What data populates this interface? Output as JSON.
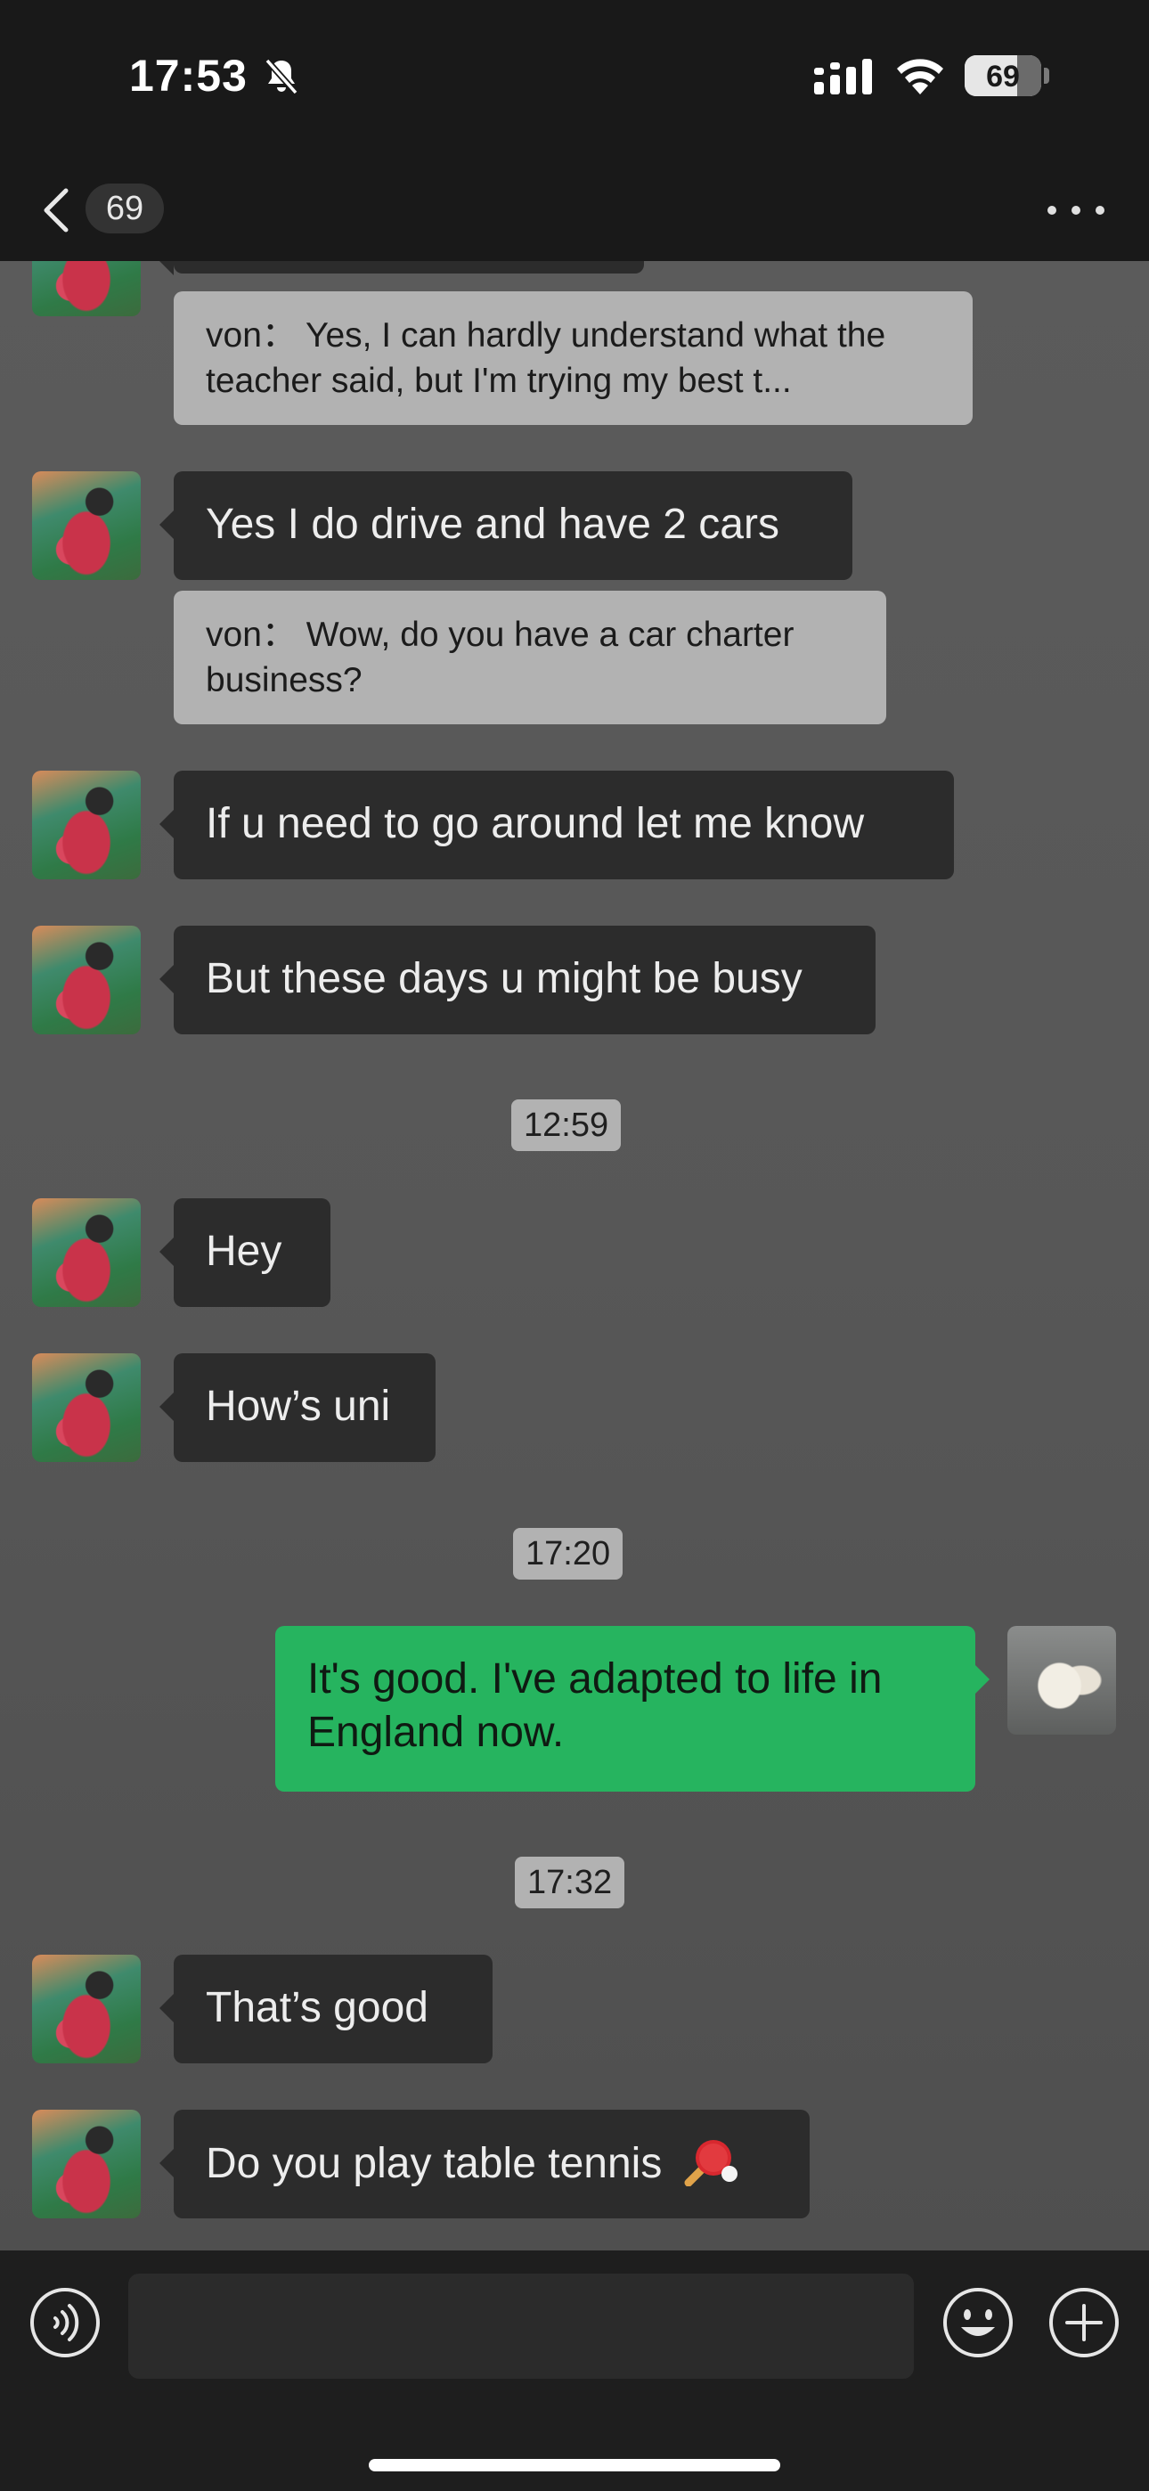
{
  "status_bar": {
    "time": "17:53",
    "battery_level": "69",
    "battery_fraction": 0.69,
    "icons": [
      "bell-off-icon",
      "signal-icon",
      "wifi-icon",
      "battery-icon"
    ]
  },
  "nav": {
    "unread_count": "69",
    "icons": [
      "chevron-left-icon",
      "more-icon"
    ]
  },
  "messages": [
    {
      "type": "quote",
      "text": "von： Yes, I can hardly understand what the teacher said, but I'm trying my best t..."
    },
    {
      "type": "incoming",
      "text": "Yes I do drive and have 2 cars"
    },
    {
      "type": "quote",
      "text": "von： Wow, do you have a car charter business?"
    },
    {
      "type": "incoming",
      "text": "If u need to go around let me know"
    },
    {
      "type": "incoming",
      "text": "But these days u might be busy"
    },
    {
      "type": "time",
      "text": "12:59"
    },
    {
      "type": "incoming",
      "text": "Hey"
    },
    {
      "type": "incoming",
      "text": "How’s uni"
    },
    {
      "type": "time",
      "text": "17:20"
    },
    {
      "type": "outgoing",
      "text": "It's good. I've adapted to life in England now."
    },
    {
      "type": "time",
      "text": "17:32"
    },
    {
      "type": "incoming",
      "text": "That’s good"
    },
    {
      "type": "incoming",
      "text": "Do you play table tennis",
      "emoji": "table-tennis-paddle"
    }
  ],
  "input_bar": {
    "placeholder": "",
    "icons": [
      "voice-icon",
      "emoji-icon",
      "plus-icon"
    ]
  },
  "colors": {
    "outgoing_bubble": "#26b45f",
    "incoming_bubble": "#2c2c2c",
    "quote_bubble": "#b2b2b2",
    "chat_background": "#5a5a5a",
    "bar_background": "#191919"
  }
}
